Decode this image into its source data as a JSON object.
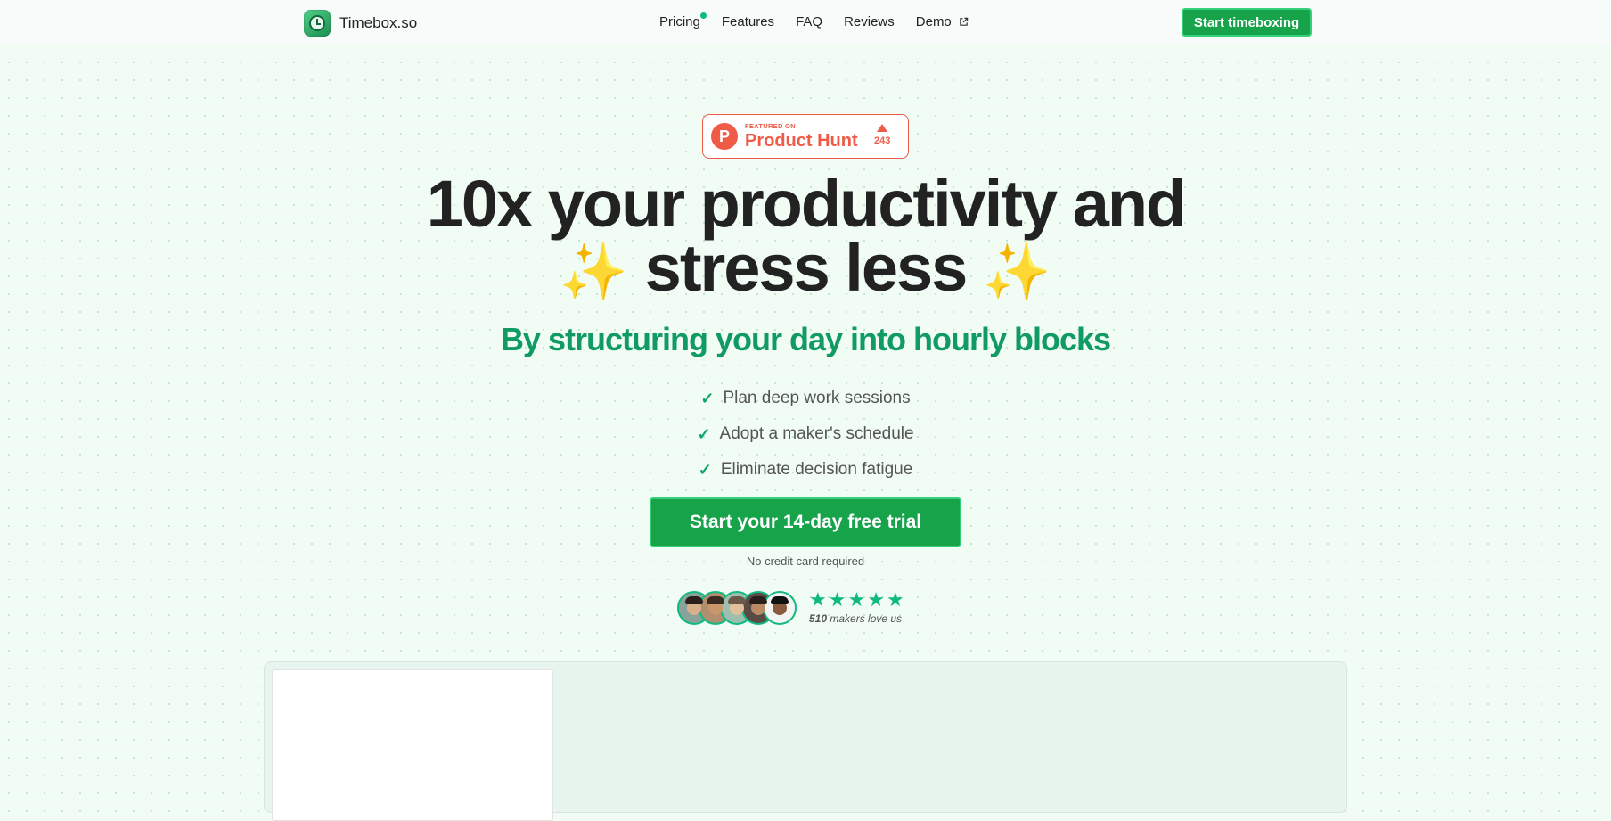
{
  "header": {
    "brand": "Timebox.so",
    "nav": [
      {
        "label": "Pricing",
        "has_dot": true
      },
      {
        "label": "Features"
      },
      {
        "label": "FAQ"
      },
      {
        "label": "Reviews"
      },
      {
        "label": "Demo",
        "icon": "external-link-icon"
      }
    ],
    "cta_label": "Start timeboxing",
    "accent_color": "#16a34a"
  },
  "product_hunt": {
    "featured_label": "FEATURED ON",
    "name": "Product Hunt",
    "votes": "243",
    "color": "#ef5b47"
  },
  "hero": {
    "headline_line1": "10x your productivity and",
    "headline_line2": "stress less",
    "sparkle": "✨",
    "subheadline": "By structuring your day into hourly blocks",
    "subheadline_color": "#0f9b62",
    "bullets": [
      "Plan deep work sessions",
      "Adopt a maker's schedule",
      "Eliminate decision fatigue"
    ],
    "cta_label": "Start your 14-day free trial",
    "cta_note": "No credit card required"
  },
  "social_proof": {
    "avatar_count": 5,
    "stars": 5,
    "count": "510",
    "label": " makers love us"
  }
}
